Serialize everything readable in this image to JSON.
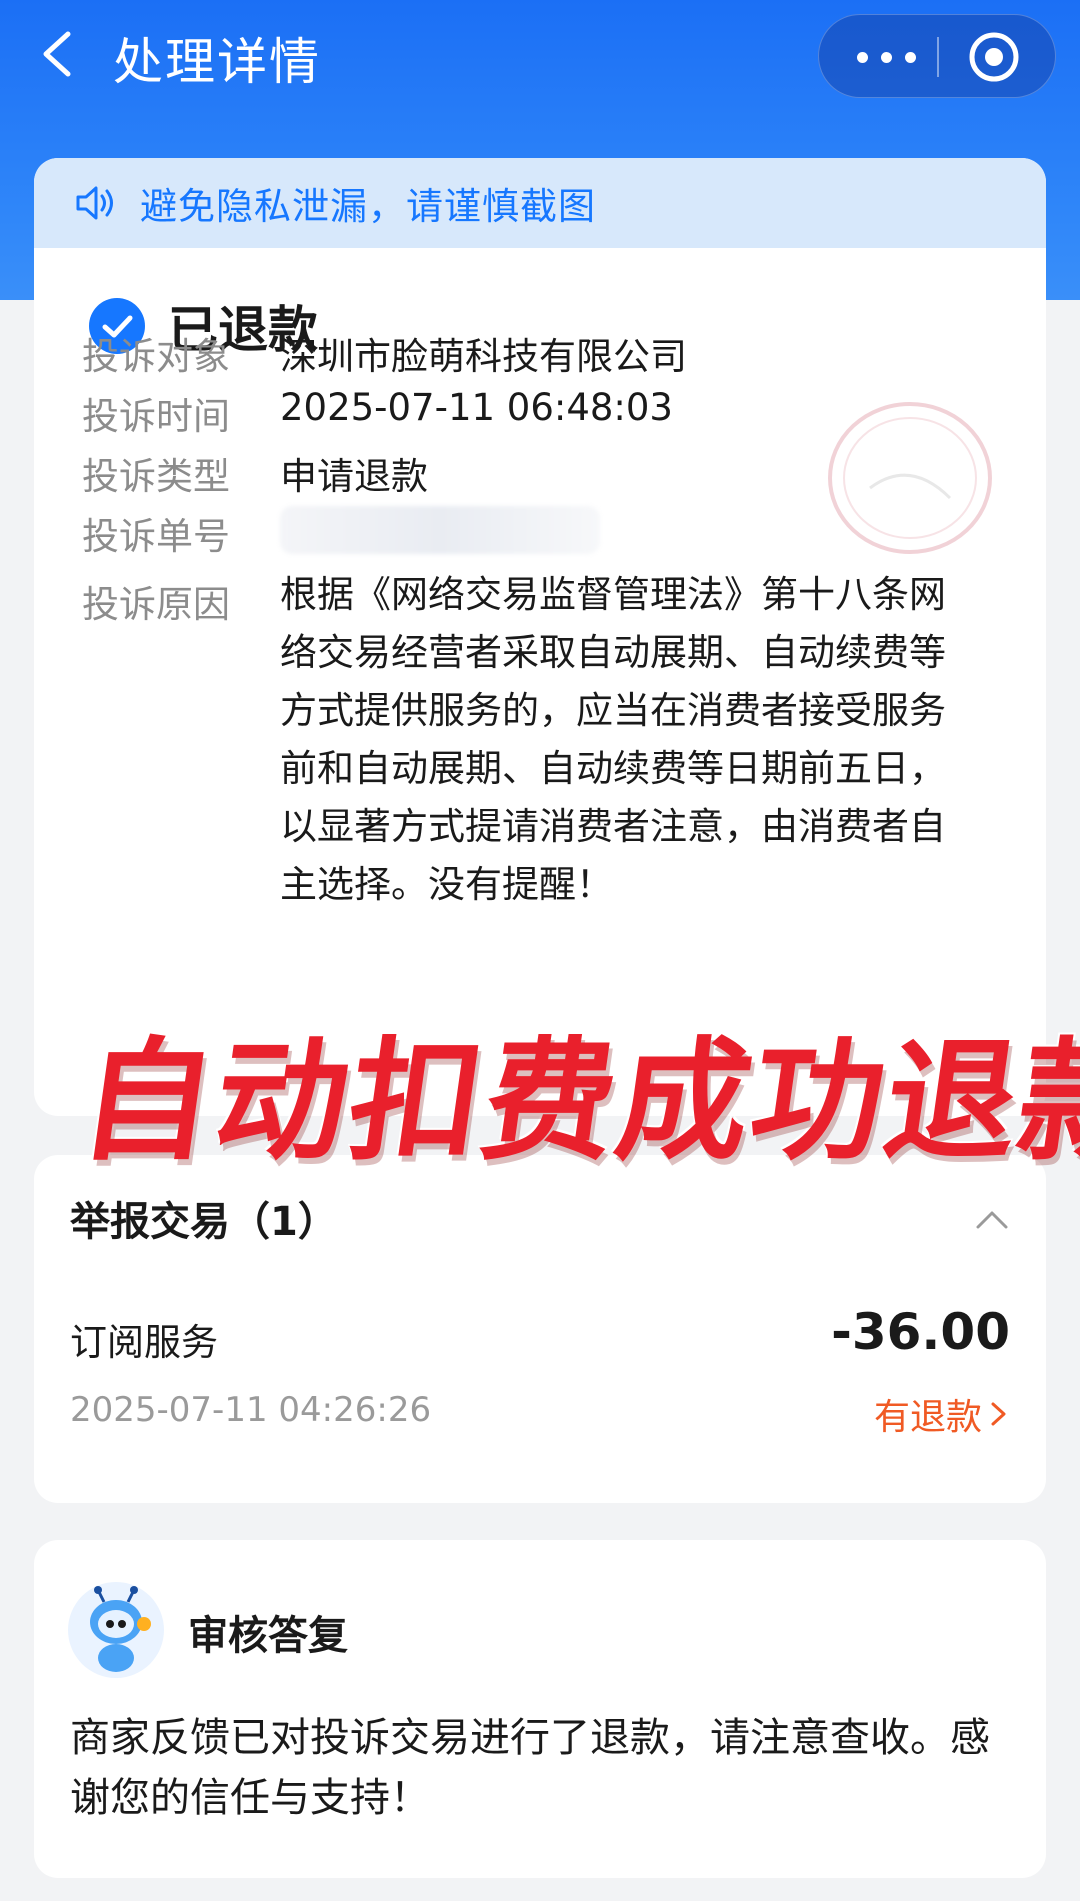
{
  "header": {
    "title": "处理详情"
  },
  "notice": {
    "text": "避免隐私泄漏，请谨慎截图"
  },
  "complaint": {
    "status": "已退款",
    "rows": [
      {
        "label": "投诉对象",
        "value": "深圳市脸萌科技有限公司"
      },
      {
        "label": "投诉时间",
        "value": "2025-07-11 06:48:03"
      },
      {
        "label": "投诉类型",
        "value": "申请退款"
      },
      {
        "label": "投诉单号",
        "value": ""
      },
      {
        "label": "投诉原因",
        "value": "根据《网络交易监督管理法》第十八条网络交易经营者采取自动展期、自动续费等方式提供服务的，应当在消费者接受服务前和自动展期、自动续费等日期前五日，以显著方式提请消费者注意，由消费者自主选择。没有提醒！"
      }
    ]
  },
  "overlay_text": "自动扣费成功退款",
  "trade": {
    "title": "举报交易（1）",
    "name": "订阅服务",
    "amount": "-36.00",
    "time": "2025-07-11 04:26:26",
    "refund_label": "有退款"
  },
  "reply": {
    "title": "审核答复",
    "text": "商家反馈已对投诉交易进行了退款，请注意查收。感谢您的信任与支持！"
  },
  "colors": {
    "header_blue": "#1b6ff5",
    "notice_bg": "#d7e8fb",
    "notice_text": "#1677ff",
    "overlay_red": "#e9202c",
    "refund_orange": "#f05a24"
  },
  "icons": [
    "back-arrow-icon",
    "more-dots-icon",
    "target-icon",
    "speaker-icon",
    "check-circle-icon",
    "chevron-up-icon",
    "chevron-right-icon",
    "robot-avatar-icon"
  ]
}
